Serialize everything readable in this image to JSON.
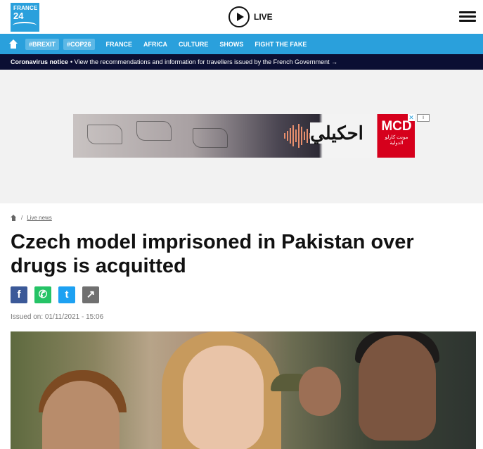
{
  "header": {
    "logo_line1": "FRANCE",
    "logo_line2": "24",
    "live_label": "LIVE"
  },
  "nav": {
    "tags": [
      "#BREXIT",
      "#COP26"
    ],
    "links": [
      "FRANCE",
      "AFRICA",
      "CULTURE",
      "SHOWS",
      "FIGHT THE FAKE"
    ]
  },
  "notice": {
    "title": "Coronavirus notice",
    "text": "• View the recommendations and information for travellers issued by the French Government →"
  },
  "ad": {
    "arabic_text": "احكيلي",
    "brand": "MCD",
    "brand_sub": "مونت كارلو الدولية",
    "close_glyph": "✕",
    "info_glyph": "i"
  },
  "breadcrumb": {
    "section": "Live news"
  },
  "article": {
    "title": "Czech model imprisoned in Pakistan over drugs is acquitted",
    "issued": "Issued on: 01/11/2021 - 15:06"
  },
  "share": {
    "facebook_glyph": "f",
    "whatsapp_glyph": "✆",
    "twitter_glyph": "t",
    "share_glyph": "↗"
  },
  "colors": {
    "brand_blue": "#2aa0dc",
    "notice_bg": "#0b0f33"
  }
}
